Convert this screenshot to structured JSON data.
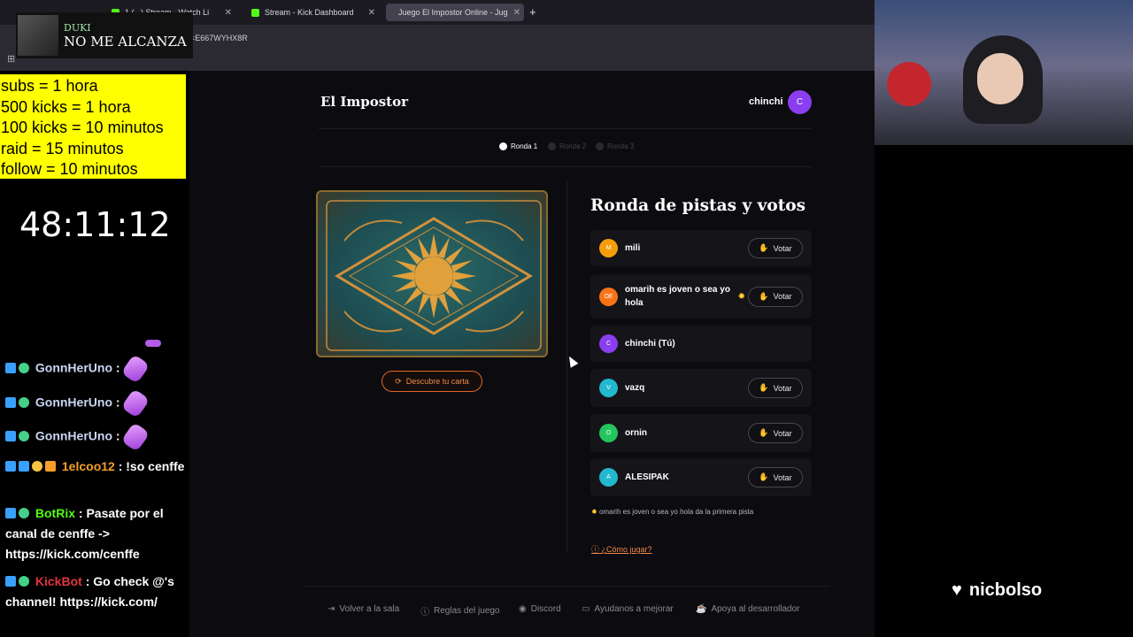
{
  "browser": {
    "tabs": [
      {
        "label": "1 (...) Stream - Watch Li",
        "favicon_color": "#53fc18"
      },
      {
        "label": "Stream - Kick Dashboard",
        "favicon_color": "#53fc18"
      },
      {
        "label": "Juego El Impostor Online - Jug",
        "favicon_color": "#e0672a"
      }
    ],
    "url_fragment": "=E667WYHX8R"
  },
  "overlay": {
    "song_artist": "DUKI",
    "song_title": "NO ME ALCANZA",
    "rules": [
      "subs = 1 hora",
      "500 kicks = 1 hora",
      "100 kicks = 10 minutos",
      "raid = 15 minutos",
      "follow = 10 minutos"
    ],
    "timer": "48:11:12",
    "follow_name": "nicbolso"
  },
  "chat": [
    {
      "user": "GonnHerUno",
      "user_color": "#c9d6f2",
      "text": ":",
      "emote": true
    },
    {
      "user": "GonnHerUno",
      "user_color": "#c9d6f2",
      "text": ":",
      "emote": true
    },
    {
      "user": "GonnHerUno",
      "user_color": "#c9d6f2",
      "text": ":",
      "emote": true
    },
    {
      "user": "1elcoo12",
      "user_color": "#f59e2a",
      "text": ": !so cenffe"
    },
    {
      "user": "BotRix",
      "user_color": "#53fc18",
      "text": ": Pasate por el canal de cenffe -> https://kick.com/cenffe"
    },
    {
      "user": "KickBot",
      "user_color": "#e0353b",
      "text": ": Go check @'s channel! https://kick.com/"
    }
  ],
  "game": {
    "brand": "El Impostor",
    "user": {
      "name": "chinchi",
      "initial": "C"
    },
    "rounds": [
      {
        "label": "Ronda 1",
        "active": true
      },
      {
        "label": "Ronda 2",
        "active": false
      },
      {
        "label": "Ronda 3",
        "active": false
      }
    ],
    "reveal_label": "Descubre tu carta",
    "panel_title": "Ronda de pistas y votos",
    "vote_label": "Votar",
    "players": [
      {
        "name": "mili",
        "initials": "M",
        "color": "#f59e0b",
        "can_vote": true,
        "starter": false
      },
      {
        "name": "omarih es joven o sea yo hola",
        "initials": "OE",
        "color": "#f97316",
        "can_vote": true,
        "starter": true
      },
      {
        "name": "chinchi (Tú)",
        "initials": "C",
        "color": "#8b3df0",
        "can_vote": false,
        "starter": false
      },
      {
        "name": "vazq",
        "initials": "V",
        "color": "#22b8cf",
        "can_vote": true,
        "starter": false
      },
      {
        "name": "ornin",
        "initials": "O",
        "color": "#22c55e",
        "can_vote": true,
        "starter": false
      },
      {
        "name": "ALESIPAK",
        "initials": "A",
        "color": "#22b8cf",
        "can_vote": true,
        "starter": false
      }
    ],
    "hint": "omarih es joven o sea yo hola da la primera pista",
    "howto": "¿Cómo jugar?",
    "footer": [
      {
        "label": "Volver a la sala",
        "icon": "exit-icon"
      },
      {
        "label": "Reglas del juego",
        "icon": "info-icon"
      },
      {
        "label": "Discord",
        "icon": "discord-icon"
      },
      {
        "label": "Ayudanos a mejorar",
        "icon": "feedback-icon"
      },
      {
        "label": "Apoya al desarrollador",
        "icon": "coffee-icon"
      }
    ]
  }
}
